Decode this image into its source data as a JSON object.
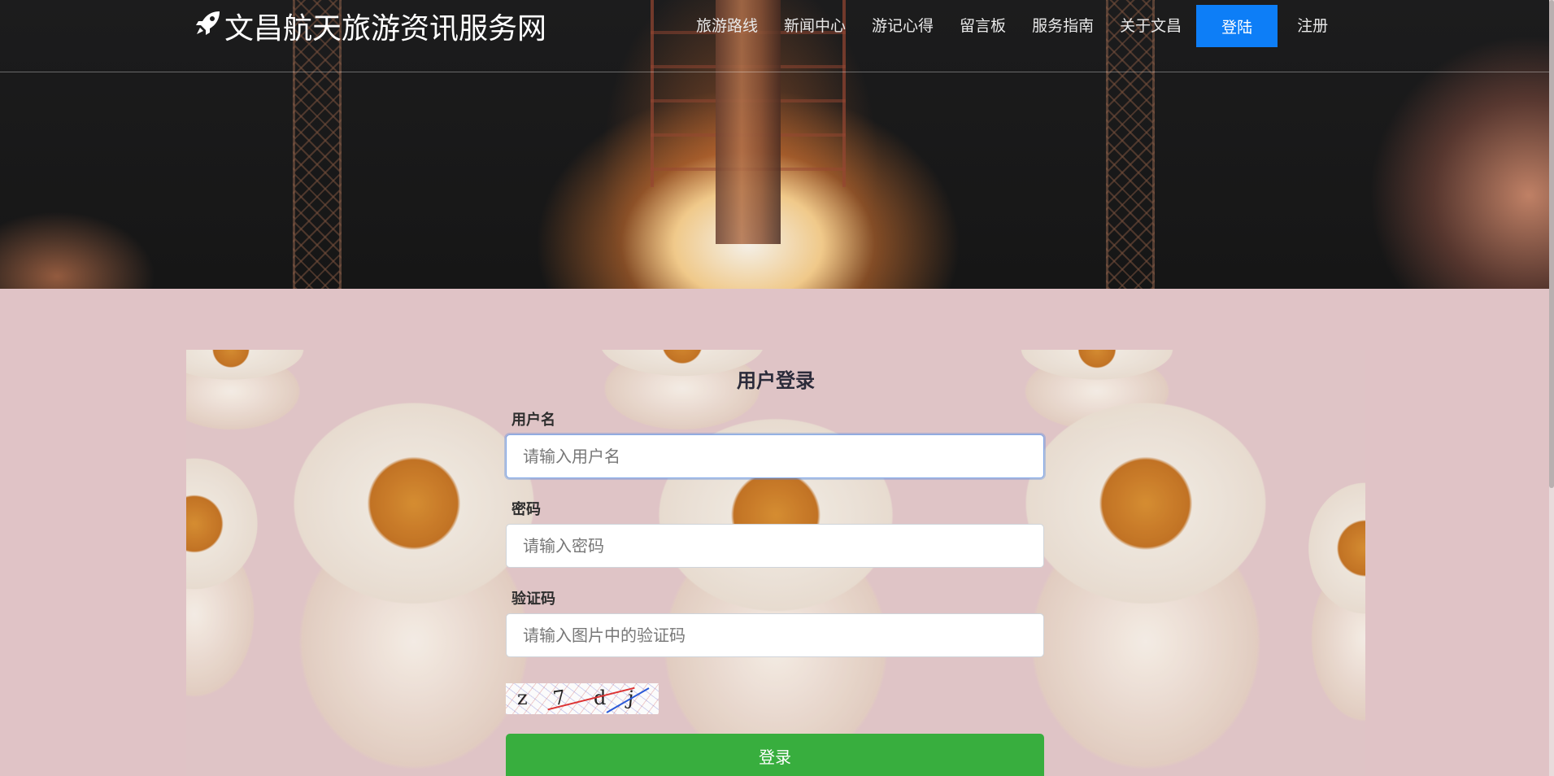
{
  "header": {
    "brand_icon": "rocket-icon",
    "brand_title": "文昌航天旅游资讯服务网",
    "nav_items": [
      {
        "label": "旅游路线"
      },
      {
        "label": "新闻中心"
      },
      {
        "label": "游记心得"
      },
      {
        "label": "留言板"
      },
      {
        "label": "服务指南"
      },
      {
        "label": "关于文昌"
      }
    ],
    "login_label": "登陆",
    "register_label": "注册",
    "accent_color": "#0d7ef7"
  },
  "login_form": {
    "title": "用户登录",
    "username": {
      "label": "用户名",
      "placeholder": "请输入用户名",
      "value": ""
    },
    "password": {
      "label": "密码",
      "placeholder": "请输入密码",
      "value": ""
    },
    "captcha": {
      "label": "验证码",
      "placeholder": "请输入图片中的验证码",
      "value": "",
      "image_text": [
        "z",
        "7",
        "d",
        "j"
      ]
    },
    "submit_label": "登录",
    "submit_color": "#38ae3e"
  }
}
